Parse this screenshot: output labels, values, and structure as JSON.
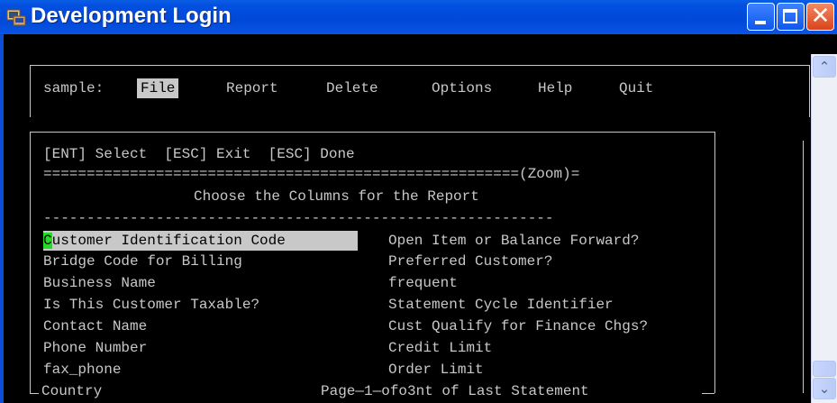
{
  "window": {
    "title": "Development Login",
    "buttons": {
      "minimize": "minimize",
      "maximize": "maximize",
      "close": "X"
    }
  },
  "menu": {
    "app_label": "sample:",
    "items": [
      "File",
      "Report",
      "Delete",
      "Options",
      "Help",
      "Quit"
    ],
    "selected": "File"
  },
  "dialog": {
    "hotkeys": "[ENT] Select  [ESC] Exit  [ESC] Done",
    "separator_top": "=======================================================(Zoom)=",
    "heading": "Choose the Columns for the Report",
    "separator_mid": "-----------------------------------------------------------",
    "cursor_char": "C",
    "left_column": [
      "ustomer Identification Code  ",
      "Bridge Code for Billing",
      "Business Name",
      "Is This Customer Taxable?",
      "Contact Name",
      "Phone Number",
      "fax_phone"
    ],
    "right_column": [
      "Open Item or Balance Forward?",
      "Preferred Customer?",
      "frequent",
      "Statement Cycle Identifier",
      "Cust Qualify for Finance Chgs?",
      "Credit Limit",
      "Order Limit"
    ],
    "bottom_left": "Country",
    "bottom_pager": "Page—1—ofo3nt of Last Statement"
  }
}
